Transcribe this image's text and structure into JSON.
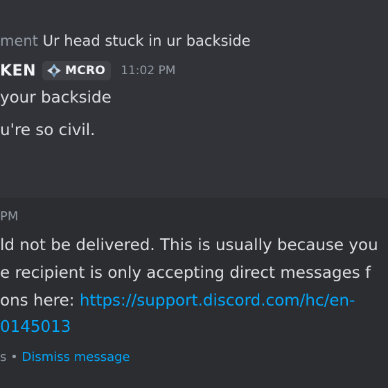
{
  "reply": {
    "author_fragment": "ment",
    "text": "Ur head stuck in ur backside"
  },
  "message": {
    "username_fragment": "KEN",
    "clan_tag": "MCRO",
    "timestamp": "11:02 PM",
    "lines": [
      "your backside",
      "u're so civil."
    ]
  },
  "system_message": {
    "timestamp_fragment": "PM",
    "line1": "ld not be delivered. This is usually because you",
    "line2": "e recipient is only accepting direct messages f",
    "line3_prefix": "ons here: ",
    "link_line1": "https://support.discord.com/hc/en-",
    "link_line2": "0145013",
    "footer_prefix": "s",
    "footer_separator": "•",
    "dismiss_label": "Dismiss message"
  },
  "colors": {
    "background": "#313338",
    "system_background": "#2b2d31",
    "text": "#dbdee1",
    "muted": "#949ba4",
    "link": "#00a8fc"
  }
}
